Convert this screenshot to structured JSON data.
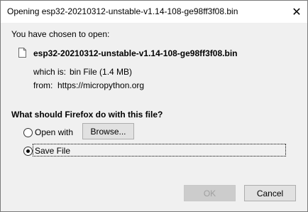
{
  "dialog": {
    "title": "Opening esp32-20210312-unstable-v1.14-108-ge98ff3f08.bin",
    "intro": "You have chosen to open:",
    "filename": "esp32-20210312-unstable-v1.14-108-ge98ff3f08.bin",
    "which_is_label": "which is:",
    "which_is_value": "bin File (1.4 MB)",
    "from_label": "from:",
    "from_value": "https://micropython.org",
    "question": "What should Firefox do with this file?",
    "options": {
      "open_with_label": "Open with",
      "save_file_label": "Save File",
      "selected": "Save File"
    },
    "browse_label": "Browse...",
    "ok_label": "OK",
    "cancel_label": "Cancel",
    "close_icon": "close-icon",
    "file_icon": "file-icon"
  }
}
